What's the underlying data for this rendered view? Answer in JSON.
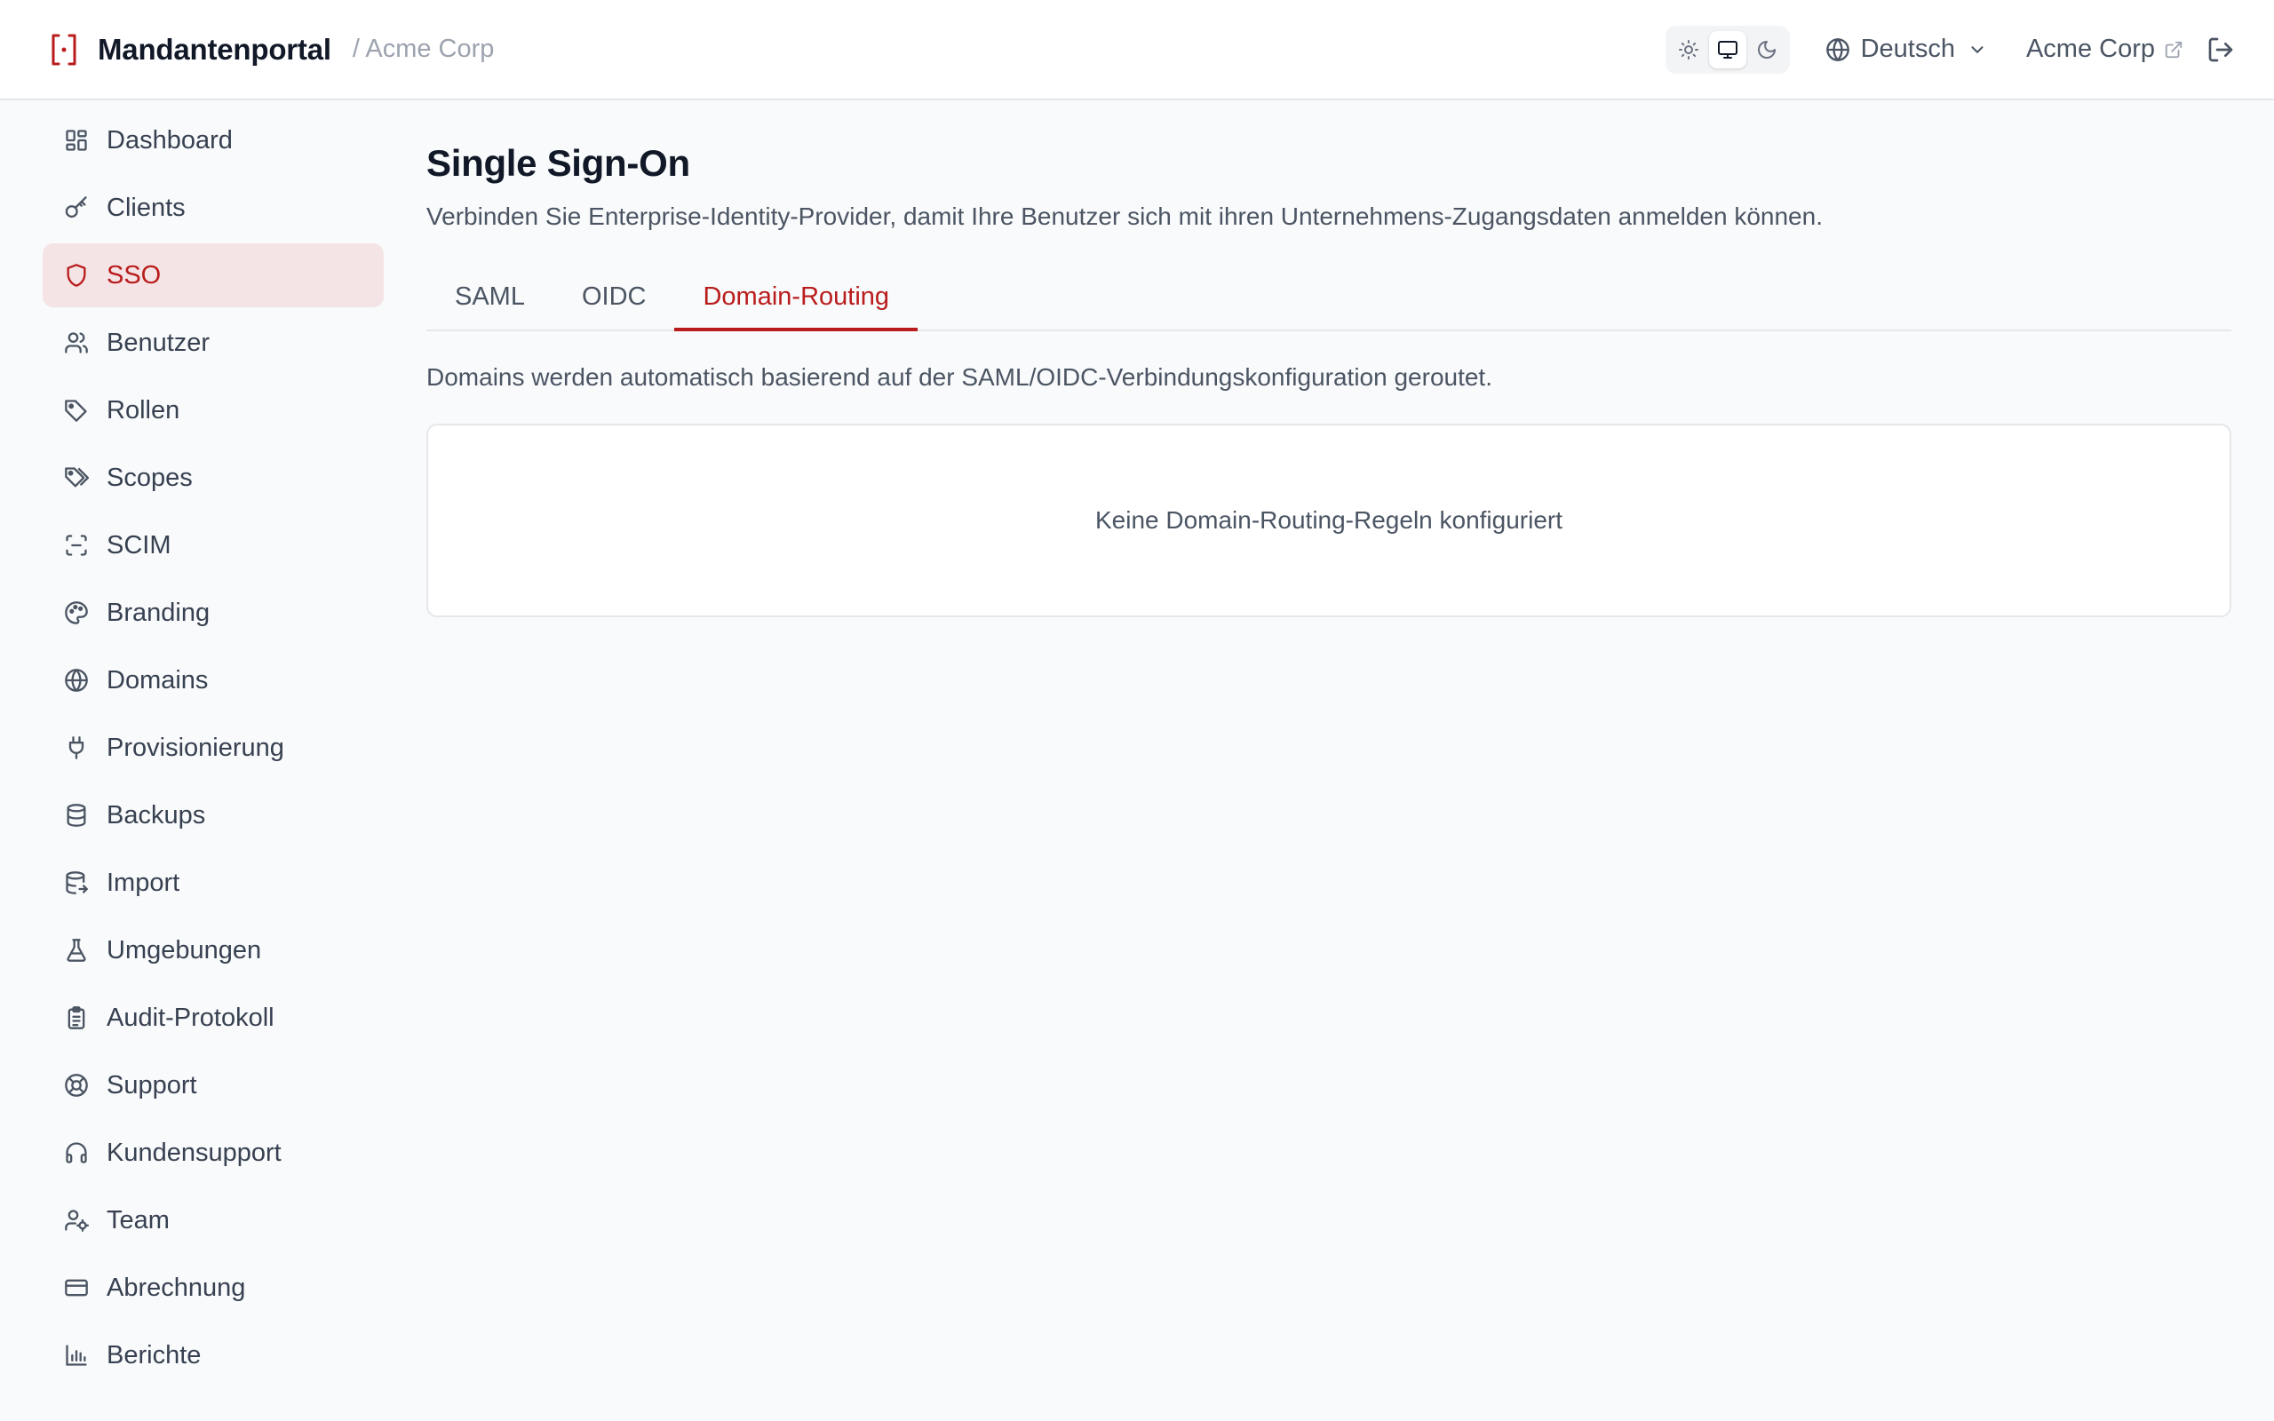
{
  "header": {
    "app_name": "Mandantenportal",
    "breadcrumb": "/ Acme Corp",
    "theme_options": [
      "light-icon",
      "system-icon",
      "dark-icon"
    ],
    "theme_selected": "system",
    "language": "Deutsch",
    "tenant_link": "Acme Corp",
    "accent_color": "#b91c1c"
  },
  "sidebar": {
    "items": [
      {
        "label": "Dashboard",
        "icon": "dashboard-icon"
      },
      {
        "label": "Clients",
        "icon": "key-icon"
      },
      {
        "label": "SSO",
        "icon": "shield-icon",
        "active": true
      },
      {
        "label": "Benutzer",
        "icon": "users-icon"
      },
      {
        "label": "Rollen",
        "icon": "tag-icon"
      },
      {
        "label": "Scopes",
        "icon": "tags-icon"
      },
      {
        "label": "SCIM",
        "icon": "scan-icon"
      },
      {
        "label": "Branding",
        "icon": "palette-icon"
      },
      {
        "label": "Domains",
        "icon": "globe-icon"
      },
      {
        "label": "Provisionierung",
        "icon": "plug-icon"
      },
      {
        "label": "Backups",
        "icon": "database-icon"
      },
      {
        "label": "Import",
        "icon": "database-import-icon"
      },
      {
        "label": "Umgebungen",
        "icon": "flask-icon"
      },
      {
        "label": "Audit-Protokoll",
        "icon": "clipboard-icon"
      },
      {
        "label": "Support",
        "icon": "lifebuoy-icon"
      },
      {
        "label": "Kundensupport",
        "icon": "headset-icon"
      },
      {
        "label": "Team",
        "icon": "user-cog-icon"
      },
      {
        "label": "Abrechnung",
        "icon": "credit-card-icon"
      },
      {
        "label": "Berichte",
        "icon": "bar-chart-icon"
      }
    ]
  },
  "main": {
    "title": "Single Sign-On",
    "description": "Verbinden Sie Enterprise-Identity-Provider, damit Ihre Benutzer sich mit ihren Unternehmens-Zugangsdaten anmelden können.",
    "tabs": [
      {
        "label": "SAML"
      },
      {
        "label": "OIDC"
      },
      {
        "label": "Domain-Routing",
        "active": true
      }
    ],
    "routing_info": "Domains werden automatisch basierend auf der SAML/OIDC-Verbindungskonfiguration geroutet.",
    "empty_state": "Keine Domain-Routing-Regeln konfiguriert"
  }
}
